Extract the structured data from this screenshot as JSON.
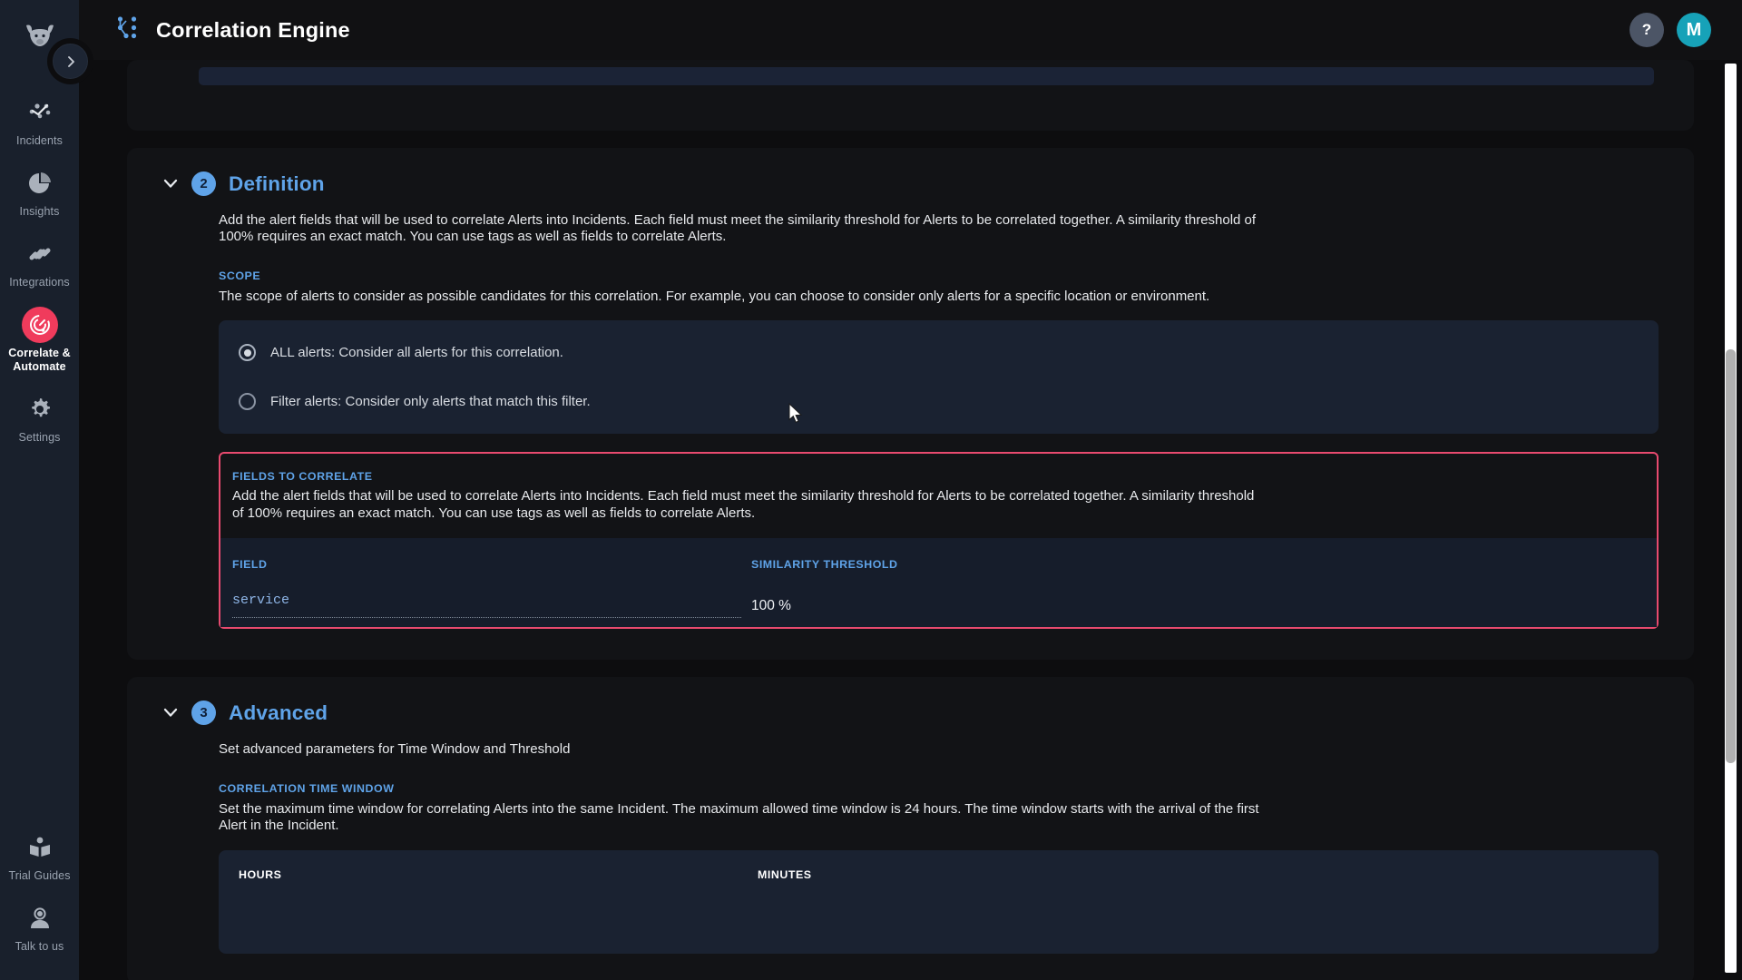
{
  "sidebar": {
    "logo_icon": "bull-head-logo",
    "collapse_icon": "chevron-right-icon",
    "top_items": [
      {
        "label": "Incidents",
        "icon": "incidents-scatter-icon",
        "active": false
      },
      {
        "label": "Insights",
        "icon": "pie-chart-icon",
        "active": false
      },
      {
        "label": "Integrations",
        "icon": "integrations-link-icon",
        "active": false
      },
      {
        "label": "Correlate & Automate",
        "icon": "target-radar-icon",
        "active": true
      },
      {
        "label": "Settings",
        "icon": "gear-icon",
        "active": false
      }
    ],
    "bottom_items": [
      {
        "label": "Trial Guides",
        "icon": "open-book-icon"
      },
      {
        "label": "Talk to us",
        "icon": "support-agent-icon"
      }
    ]
  },
  "topbar": {
    "app_icon": "correlation-graph-icon",
    "title": "Correlation Engine",
    "help_label": "?",
    "avatar_initial": "M"
  },
  "sections": {
    "definition": {
      "number": "2",
      "title": "Definition",
      "description": "Add the alert fields that will be used to correlate Alerts into Incidents. Each field must meet the similarity threshold for Alerts to be correlated together. A similarity threshold of 100% requires an exact match. You can use tags as well as fields to correlate Alerts.",
      "scope_label": "SCOPE",
      "scope_description": "The scope of alerts to consider as possible candidates for this correlation. For example, you can choose to consider only alerts for a specific location or environment.",
      "scope_options": [
        {
          "label": "ALL alerts: Consider all alerts for this correlation.",
          "selected": true
        },
        {
          "label": "Filter alerts: Consider only alerts that match this filter.",
          "selected": false
        }
      ],
      "fields_label": "FIELDS TO CORRELATE",
      "fields_description": "Add the alert fields that will be used to correlate Alerts into Incidents. Each field must meet the similarity threshold for Alerts to be correlated together. A similarity threshold of 100% requires an exact match. You can use tags as well as fields to correlate Alerts.",
      "table": {
        "columns": [
          "FIELD",
          "SIMILARITY THRESHOLD"
        ],
        "rows": [
          {
            "field": "service",
            "threshold": "100 %"
          }
        ]
      }
    },
    "advanced": {
      "number": "3",
      "title": "Advanced",
      "description": "Set advanced parameters for Time Window and Threshold",
      "time_window_label": "CORRELATION TIME WINDOW",
      "time_window_description": "Set the maximum time window for correlating Alerts into the same Incident. The maximum allowed time window is 24 hours. The time window starts with the arrival of the first Alert in the Incident.",
      "time_columns": [
        "HOURS",
        "MINUTES"
      ]
    }
  },
  "colors": {
    "accent_blue": "#5fa3e8",
    "highlight_red": "#e84a6f",
    "brand_pink": "#f03b5c",
    "avatar_teal": "#17a2b8",
    "panel_bg": "#1a2231",
    "card_bg": "#121316",
    "page_bg": "#0d0d0f",
    "sidebar_bg": "#19202c"
  }
}
